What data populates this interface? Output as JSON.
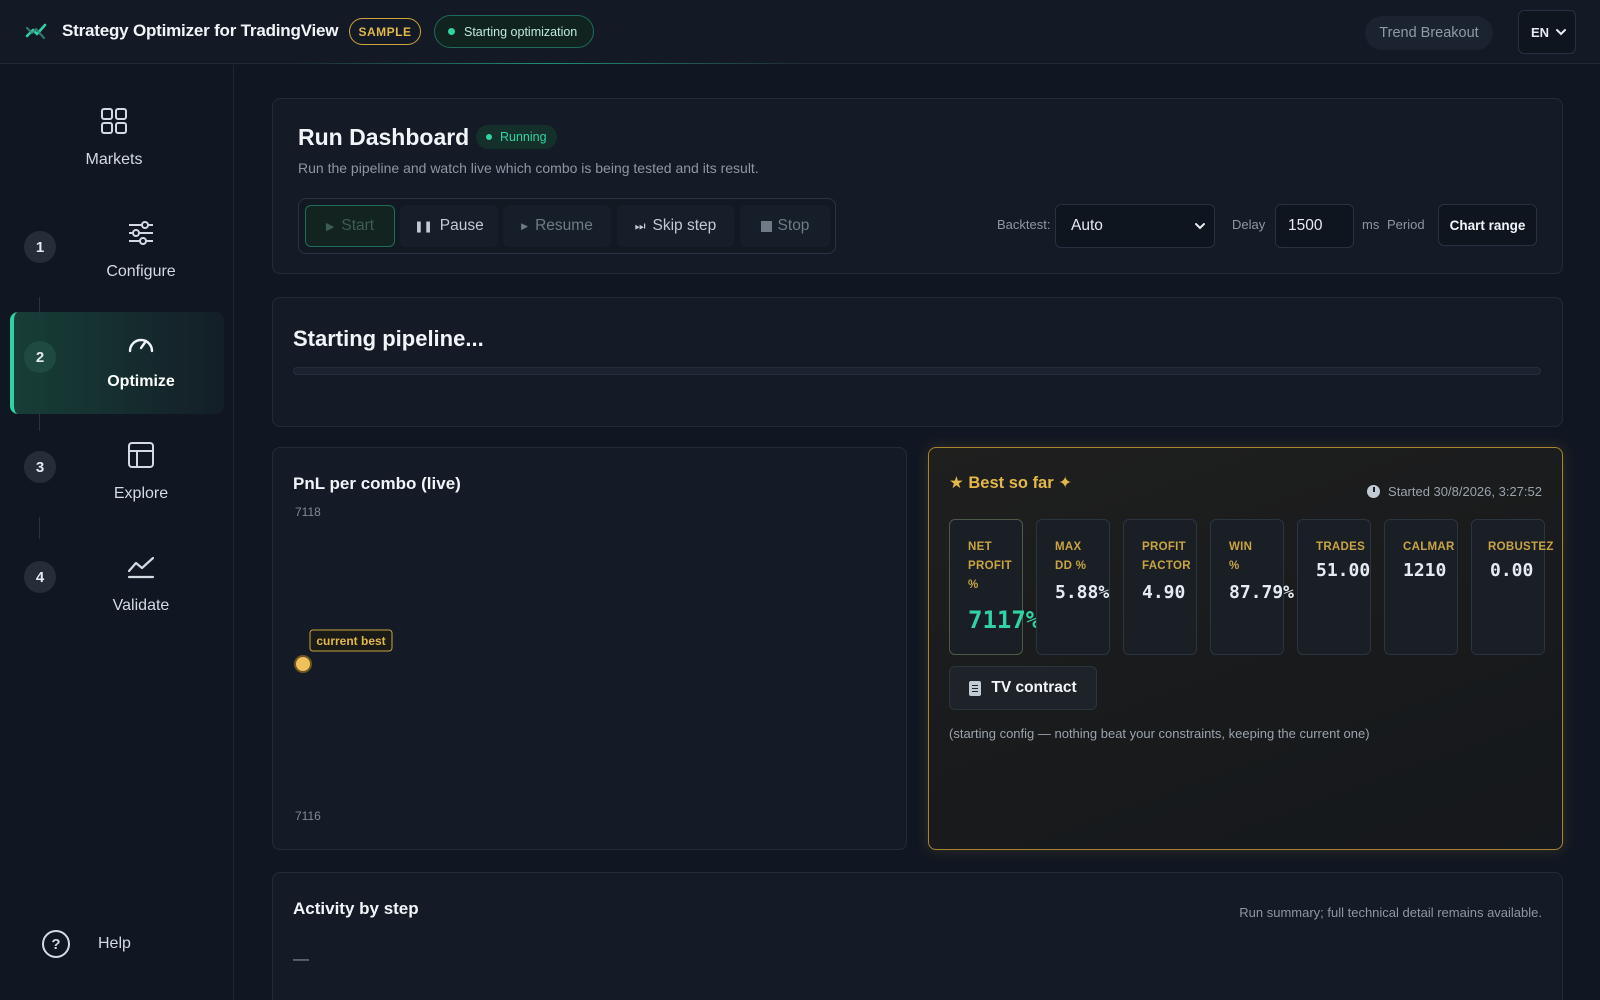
{
  "header": {
    "app_title": "Strategy Optimizer for TradingView",
    "sample_badge": "SAMPLE",
    "status_pill": "Starting optimization",
    "strategy_name": "Trend Breakout",
    "language": "EN",
    "accent_color": "#2fd3a4",
    "gold_color": "#e3b84a"
  },
  "sidebar": {
    "items": [
      {
        "label": "Markets",
        "icon": "grid-icon",
        "step": ""
      },
      {
        "label": "Configure",
        "icon": "sliders-icon",
        "step": "1"
      },
      {
        "label": "Optimize",
        "icon": "gauge-icon",
        "step": "2",
        "active": true
      },
      {
        "label": "Explore",
        "icon": "layout-icon",
        "step": "3"
      },
      {
        "label": "Validate",
        "icon": "line-chart-icon",
        "step": "4"
      }
    ],
    "help_label": "Help",
    "help_symbol": "?"
  },
  "run_dashboard": {
    "title": "Run Dashboard",
    "status_badge": "Running",
    "subtitle": "Run the pipeline and watch live which combo is being tested and its result.",
    "controls": {
      "start": "Start",
      "pause": "Pause",
      "resume": "Resume",
      "skip": "Skip step",
      "stop": "Stop"
    },
    "backtest_label": "Backtest:",
    "backtest_value": "Auto",
    "delay_label": "Delay",
    "delay_value": "1500",
    "delay_unit": "ms",
    "period_label": "Period",
    "chart_range_label": "Chart range"
  },
  "pipeline": {
    "title": "Starting pipeline...",
    "progress": 0
  },
  "pnl_chart": {
    "title": "PnL per combo (live)"
  },
  "chart_data": {
    "type": "scatter",
    "title": "PnL per combo (live)",
    "y_tick_labels": [
      "7118",
      "7116"
    ],
    "ylim": [
      7116,
      7118
    ],
    "points": [
      {
        "x": 1,
        "y": 7117,
        "label": "current best"
      }
    ],
    "annotation": "current best",
    "grid": false
  },
  "best": {
    "title": "★ Best so far ✦",
    "started": "Started 30/8/2026, 3:27:52",
    "metrics": [
      {
        "label": "NET PROFIT %",
        "value": "7117%"
      },
      {
        "label": "MAX DD %",
        "value": "5.88%"
      },
      {
        "label": "PROFIT FACTOR",
        "value": "4.90"
      },
      {
        "label": "WIN %",
        "value": "87.79%"
      },
      {
        "label": "TRADES",
        "value": "51.00"
      },
      {
        "label": "CALMAR",
        "value": "1210"
      },
      {
        "label": "ROBUSTEZ",
        "value": "0.00"
      }
    ],
    "tv_contract_label": "TV contract",
    "note": "(starting config — nothing beat your constraints, keeping the current one)"
  },
  "activity": {
    "title": "Activity by step",
    "subtitle": "Run summary; full technical detail remains available.",
    "placeholder": "—"
  }
}
